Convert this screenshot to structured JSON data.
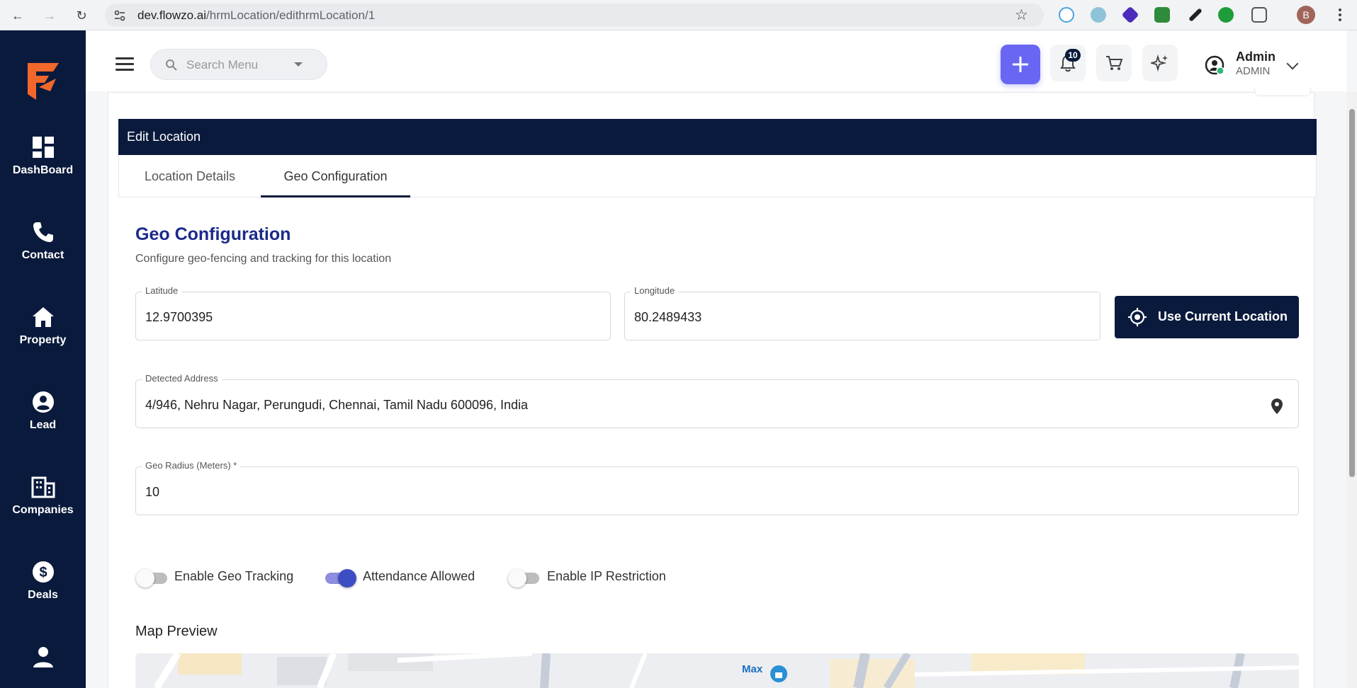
{
  "browser": {
    "url_host": "dev.flowzo.ai",
    "url_path": "/hrmLocation/edithrmLocation/1",
    "profile_initial": "B"
  },
  "sidebar": {
    "items": [
      {
        "label": "DashBoard",
        "icon": "dashboard-icon"
      },
      {
        "label": "Contact",
        "icon": "phone-icon"
      },
      {
        "label": "Property",
        "icon": "home-icon"
      },
      {
        "label": "Lead",
        "icon": "person-circle-icon"
      },
      {
        "label": "Companies",
        "icon": "building-icon"
      },
      {
        "label": "Deals",
        "icon": "dollar-icon"
      }
    ]
  },
  "header": {
    "search_placeholder": "Search Menu",
    "notifications_count": "10",
    "user_name": "Admin",
    "user_role": "ADMIN",
    "accent": "#6866f2"
  },
  "page": {
    "card_title": "Edit Location",
    "tabs": [
      {
        "label": "Location Details",
        "active": false
      },
      {
        "label": "Geo Configuration",
        "active": true
      }
    ],
    "section_title": "Geo Configuration",
    "section_subtitle": "Configure geo-fencing and tracking for this location",
    "latitude": {
      "label": "Latitude",
      "value": "12.9700395"
    },
    "longitude": {
      "label": "Longitude",
      "value": "80.2489433"
    },
    "use_location_label": "Use Current Location",
    "address": {
      "label": "Detected Address",
      "value": "4/946, Nehru Nagar, Perungudi, Chennai, Tamil Nadu 600096, India"
    },
    "radius": {
      "label": "Geo Radius (Meters) *",
      "value": "10"
    },
    "toggles": [
      {
        "label": "Enable Geo Tracking",
        "on": false
      },
      {
        "label": "Attendance Allowed",
        "on": true
      },
      {
        "label": "Enable IP Restriction",
        "on": false
      }
    ],
    "map_title": "Map Preview",
    "map_labels": {
      "place": "Max"
    }
  },
  "colors": {
    "navy": "#0a1a3c",
    "title_blue": "#1b2a8a"
  }
}
